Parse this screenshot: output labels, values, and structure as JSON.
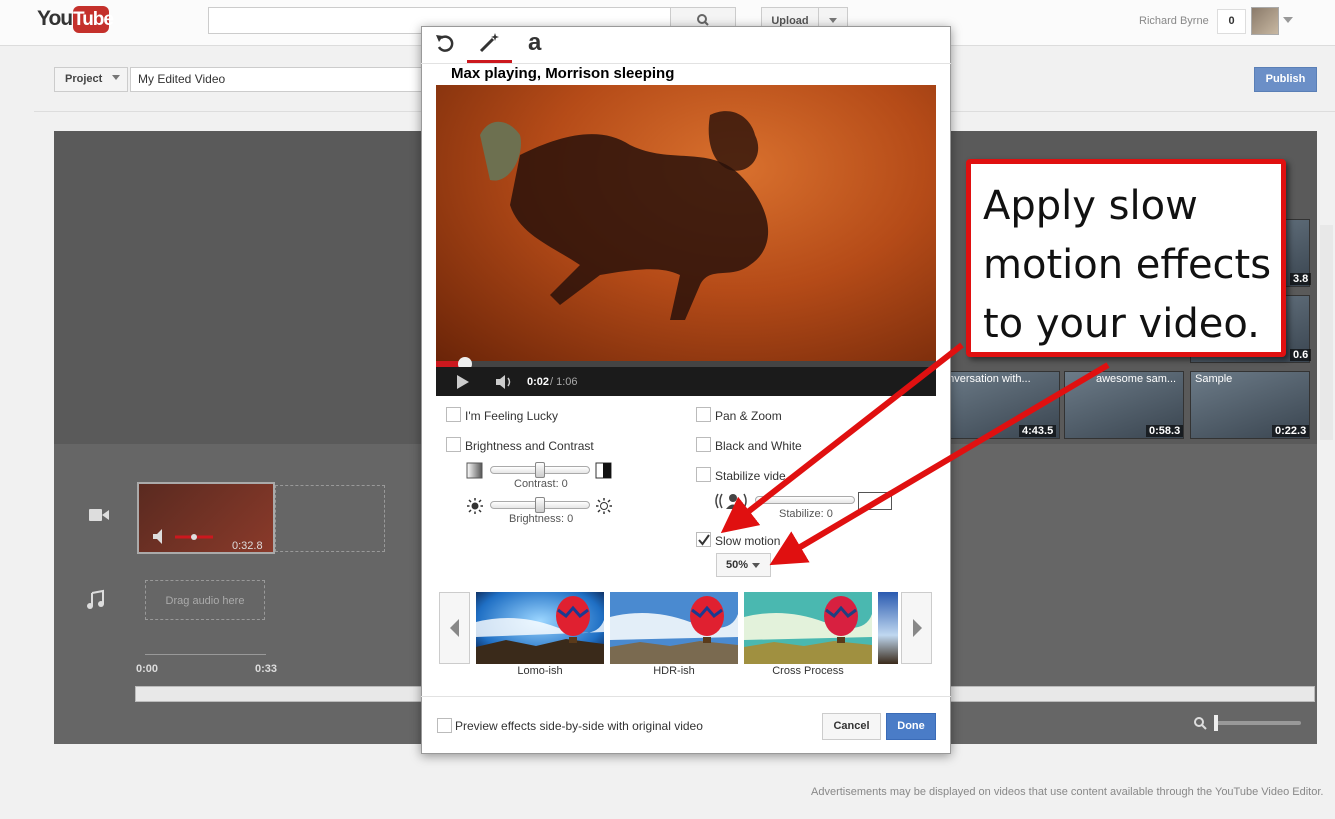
{
  "header": {
    "logo_you": "You",
    "logo_tube": "Tube",
    "upload_label": "Upload",
    "user_name": "Richard Byrne",
    "notification_count": "0"
  },
  "project_bar": {
    "project_label": "Project",
    "project_name": "My Edited Video",
    "publish_label": "Publish"
  },
  "library": {
    "items": [
      {
        "title": "",
        "duration": "3.8"
      },
      {
        "title": "",
        "duration": "0.6"
      },
      {
        "title": "onversation with...",
        "duration": "4:43.5"
      },
      {
        "title": "awesome sam...",
        "duration": "0:58.3"
      },
      {
        "title": "Sample",
        "duration": "0:22.3"
      }
    ]
  },
  "timeline": {
    "clip_duration": "0:32.8",
    "audio_drop": "Drag audio here",
    "start_time": "0:00",
    "end_time": "0:33"
  },
  "modal": {
    "video_title": "Max playing, Morrison sleeping",
    "current_time": "0:02",
    "duration": "/ 1:06",
    "progress_fraction": 0.03,
    "options_left": {
      "feeling_lucky": "I'm Feeling Lucky",
      "brightness_contrast": "Brightness and Contrast",
      "contrast_label": "Contrast: 0",
      "brightness_label": "Brightness: 0"
    },
    "options_right": {
      "pan_zoom": "Pan & Zoom",
      "black_white": "Black and White",
      "stabilize": "Stabilize vide",
      "stabilize_label": "Stabilize: 0",
      "slow_motion": "Slow motion",
      "slow_motion_checked": true,
      "slow_motion_value": "50%"
    },
    "filters": [
      {
        "label": "Lomo-ish"
      },
      {
        "label": "HDR-ish"
      },
      {
        "label": "Cross Process"
      }
    ],
    "side_by_side_label": "Preview effects side-by-side with original video",
    "cancel_label": "Cancel",
    "done_label": "Done"
  },
  "callout": {
    "text": "Apply slow motion effects to your video."
  },
  "footer": {
    "note": "Advertisements may be displayed on videos that use content available through the YouTube Video Editor."
  },
  "colors": {
    "accent_red": "#cc181e",
    "callout_red": "#e01010",
    "done_blue": "#4a7cc7"
  }
}
